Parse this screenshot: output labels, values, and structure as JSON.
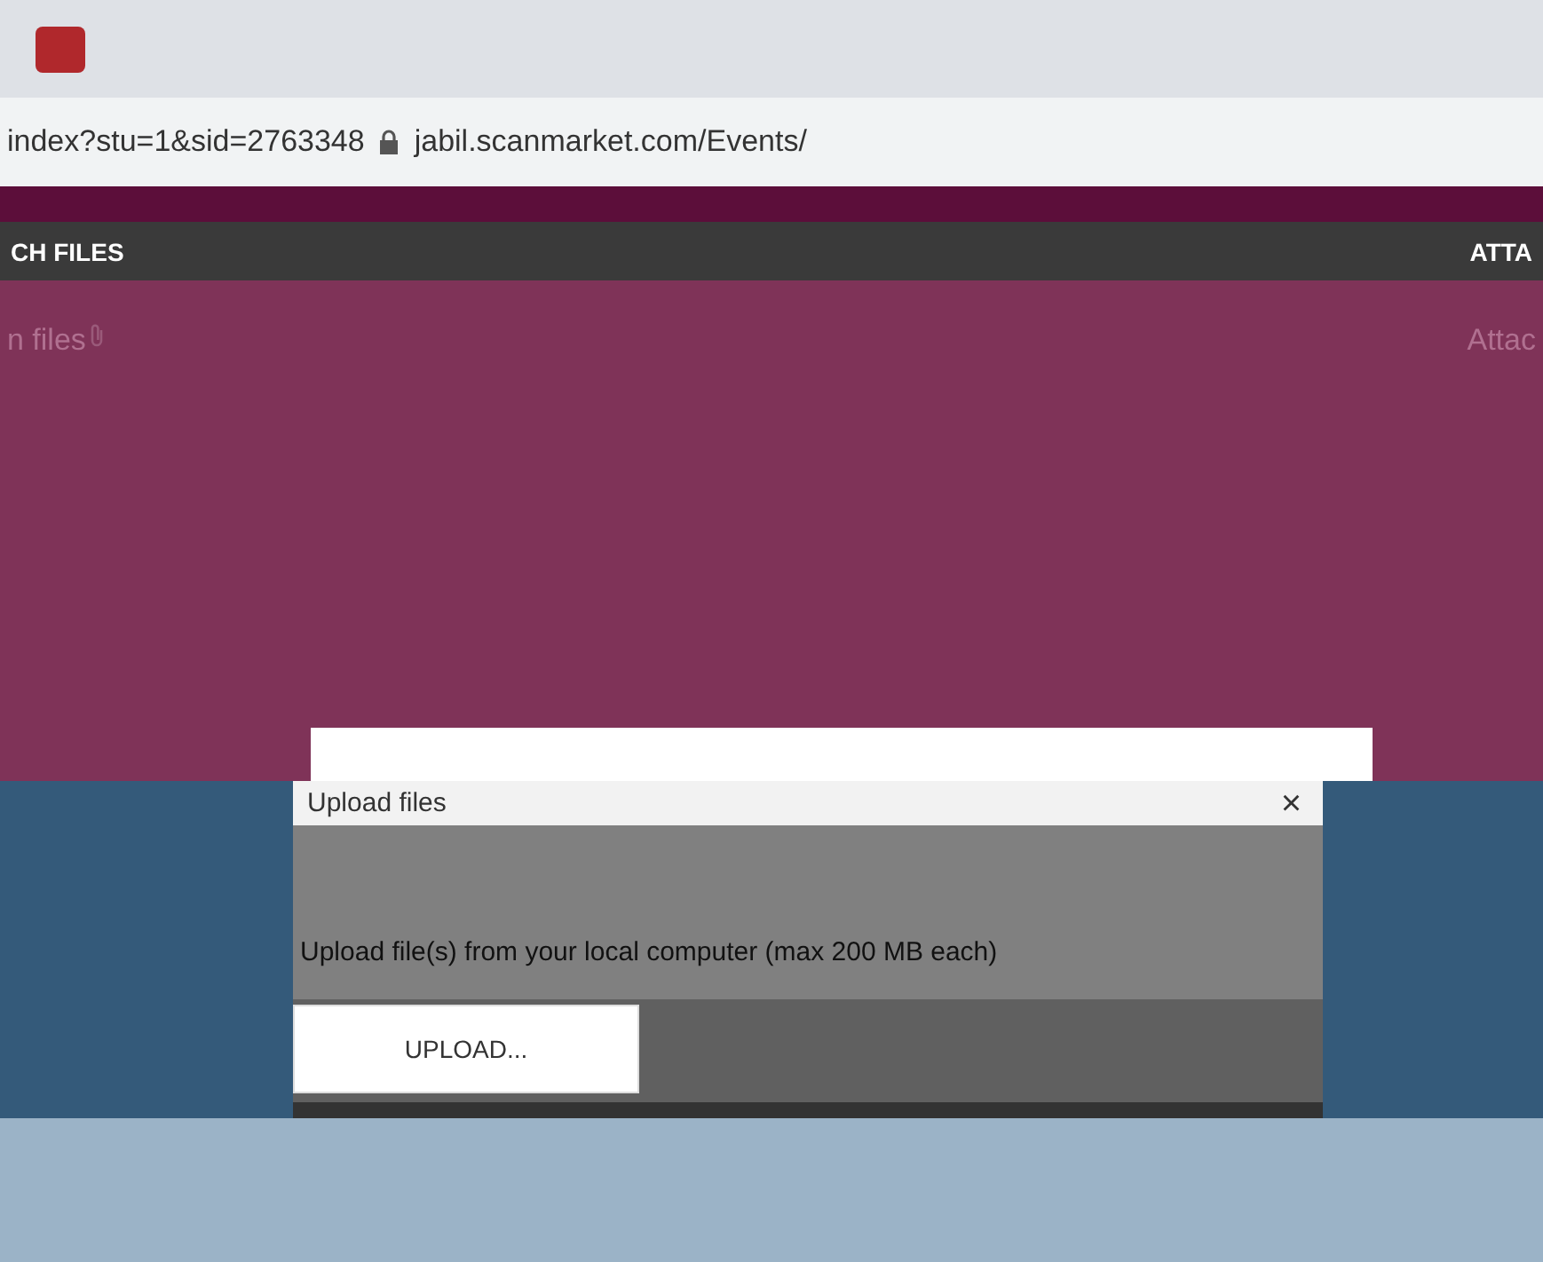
{
  "browser": {
    "url_left": "index?stu=1&sid=2763348",
    "url_right": "jabil.scanmarket.com/Events/"
  },
  "header": {
    "title": "CH FILES",
    "right": "ATTA"
  },
  "content": {
    "left": "n files",
    "right": "Attac"
  },
  "dialog": {
    "title": "Upload files",
    "close": "×",
    "text": "Upload file(s) from your local computer (max 200 MB each)",
    "button": "UPLOAD..."
  }
}
